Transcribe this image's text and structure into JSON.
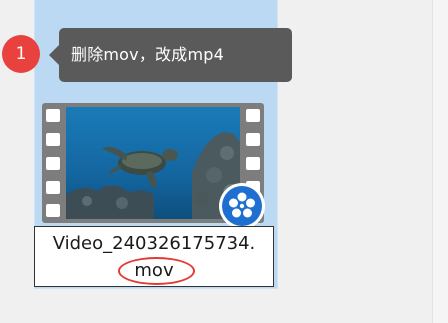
{
  "step": {
    "number": "1"
  },
  "tooltip": {
    "text": "删除mov，改成mp4"
  },
  "file": {
    "name_main": "Video_240326175734.",
    "extension": "mov"
  },
  "icons": {
    "thumbnail": "video-film-thumbnail-icon",
    "app_badge": "video-player-app-icon"
  },
  "colors": {
    "tile_selected": "#bcd9f3",
    "step_badge": "#e8413e",
    "tooltip_bg": "#5a5a5a",
    "highlight_circle": "#e53935"
  }
}
